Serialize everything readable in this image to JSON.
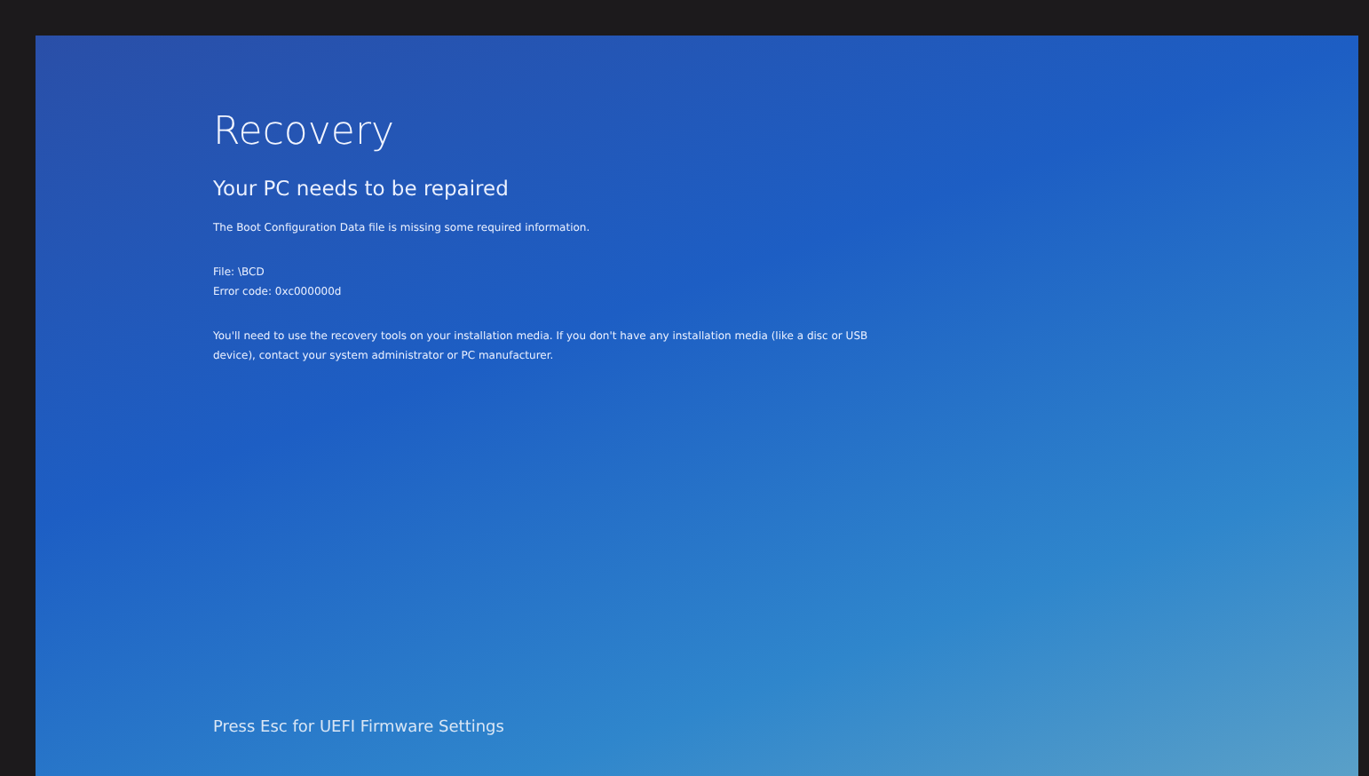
{
  "title": "Recovery",
  "heading": "Your PC needs to be repaired",
  "message": "The Boot Configuration Data file is missing some required information.",
  "details": [
    "File: \\BCD",
    "Error code: 0xc000000d"
  ],
  "instructions": "You'll need to use the recovery tools on your installation media. If you don't have any installation media (like a disc or USB device), contact your system administrator or PC manufacturer.",
  "footer": "Press Esc for UEFI Firmware Settings"
}
